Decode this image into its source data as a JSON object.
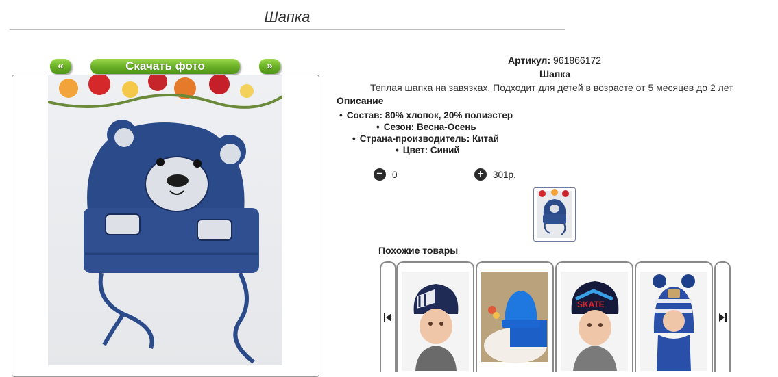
{
  "page": {
    "title": "Шапка"
  },
  "gallery": {
    "prev_label": "«",
    "download_label": "Скачать фото",
    "next_label": "»",
    "photo_icon": "product-photo"
  },
  "product": {
    "sku_label": "Артикул:",
    "sku_value": "961866172",
    "name": "Шапка",
    "description": "Теплая шапка на завязках. Подходит для детей в возрасте от 5 месяцев до 2 лет",
    "description_heading": "Описание",
    "properties": [
      "Состав: 80% хлопок, 20% полиэстер",
      "Сезон: Весна-Осень",
      "Страна-производитель: Китай",
      "Цвет: Синий"
    ],
    "quantity": "0",
    "price": "301р.",
    "minus_glyph": "−",
    "plus_glyph": "+"
  },
  "similar": {
    "heading": "Похожие товары",
    "card_text": {
      "tag": "SKATE"
    }
  },
  "colors": {
    "accent_green": "#6fb52a",
    "hat_blue": "#2b4a8a",
    "border": "#8a8a8a"
  }
}
